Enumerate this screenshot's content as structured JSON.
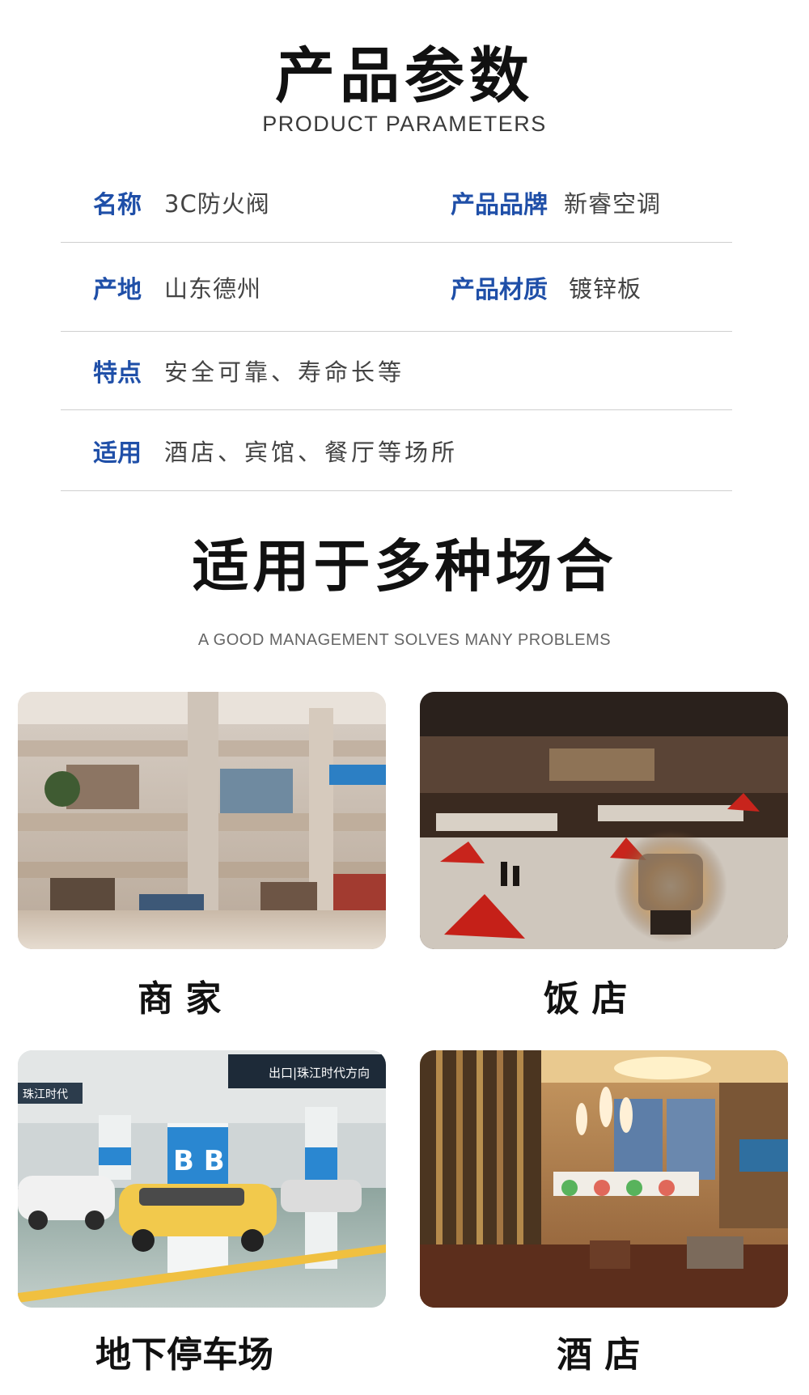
{
  "params_section": {
    "title": "产品参数",
    "subtitle": "PRODUCT PARAMETERS",
    "rows": [
      {
        "left_label": "名称",
        "left_value": "3C防火阀",
        "right_label": "产品品牌",
        "right_value": "新睿空调"
      },
      {
        "left_label": "产地",
        "left_value": "山东德州",
        "right_label": "产品材质",
        "right_value": "镀锌板"
      },
      {
        "left_label": "特点",
        "left_value": "安全可靠、寿命长等"
      },
      {
        "left_label": "适用",
        "left_value": "酒店、宾馆、餐厅等场所"
      }
    ]
  },
  "usage_section": {
    "title": "适用于多种场合",
    "subtitle": "A GOOD MANAGEMENT SOLVES MANY PROBLEMS",
    "scenes": [
      {
        "caption": "商 家",
        "image": "shopping-mall-photo"
      },
      {
        "caption": "饭 店",
        "image": "restaurant-photo"
      },
      {
        "caption": "地下停车场",
        "image": "underground-parking-photo"
      },
      {
        "caption": "酒 店",
        "image": "hotel-lobby-photo"
      }
    ],
    "photo_signage": {
      "parking_sign": "出口|珠江时代方向",
      "parking_zone_a": "B区",
      "parking_zone_b": "B区",
      "parking_left_sign": "珠江时代"
    }
  }
}
